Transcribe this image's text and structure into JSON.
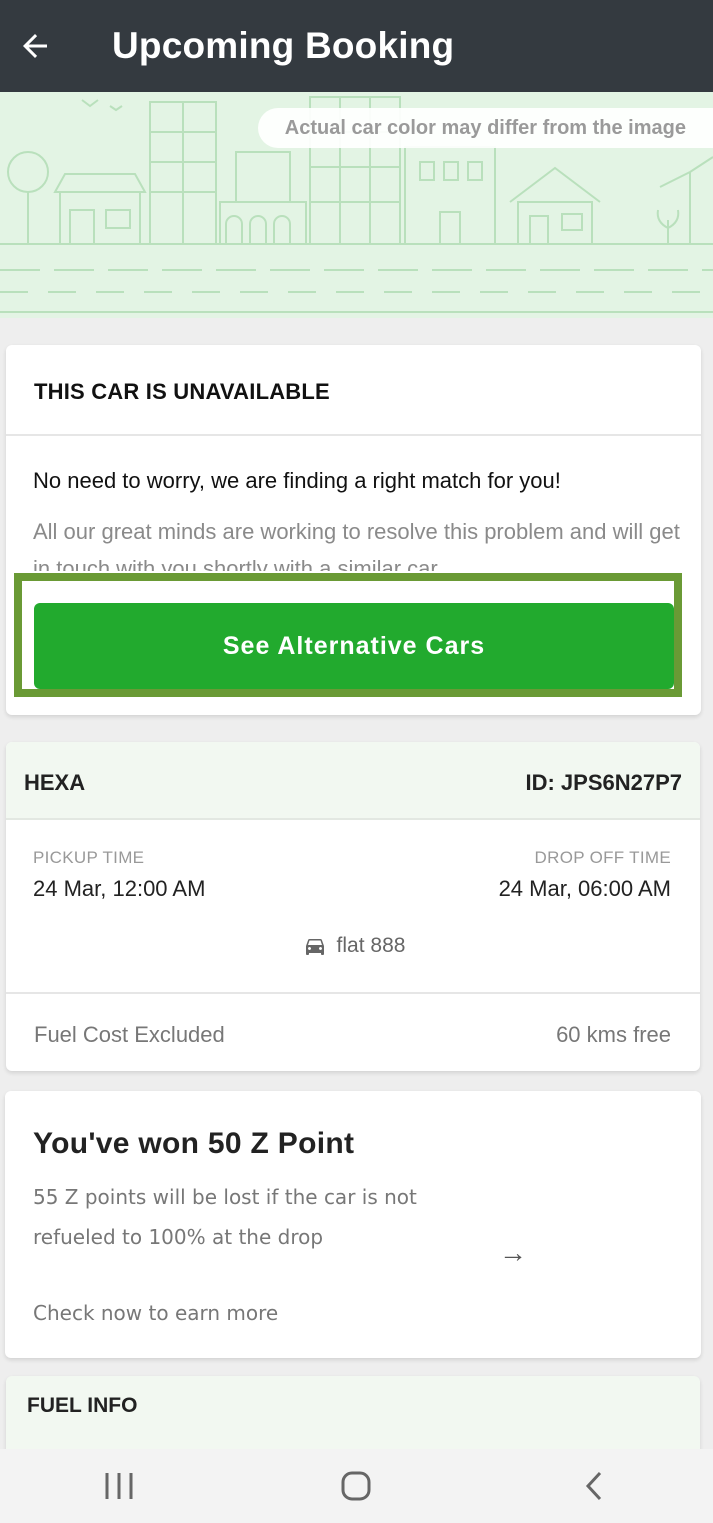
{
  "appbar": {
    "title": "Upcoming Booking"
  },
  "hero": {
    "note": "Actual car color may differ from the image"
  },
  "unavailable": {
    "title": "THIS CAR IS UNAVAILABLE",
    "message": "No need to worry, we are finding a right match for you!",
    "description": "All our great minds are working to resolve this problem and will get in touch with you shortly with a similar car",
    "button_label": "See Alternative Cars"
  },
  "booking": {
    "car_model": "HEXA",
    "id_label": "ID: JPS6N27P7",
    "pickup_label": "PICKUP TIME",
    "pickup_value": "24 Mar, 12:00 AM",
    "dropoff_label": "DROP OFF TIME",
    "dropoff_value": "24 Mar, 06:00 AM",
    "plate": "flat 888",
    "fuel_note": "Fuel Cost Excluded",
    "kms_note": "60 kms free"
  },
  "points": {
    "title": "You've won 50 Z Point",
    "description": "55 Z points will be lost if the car is not refueled to 100% at the drop",
    "cta": "Check now to earn more",
    "arrow": "→"
  },
  "fuel_info": {
    "title": "FUEL INFO"
  },
  "icons": {
    "back": "back-arrow-icon",
    "car": "car-icon",
    "recents": "recents-icon",
    "home": "home-icon",
    "nav_back": "nav-back-icon"
  },
  "colors": {
    "appbar": "#343a40",
    "accent_green": "#22aa2e",
    "highlight_frame": "#6a9a35",
    "hero_bg": "#e3f4e4"
  }
}
